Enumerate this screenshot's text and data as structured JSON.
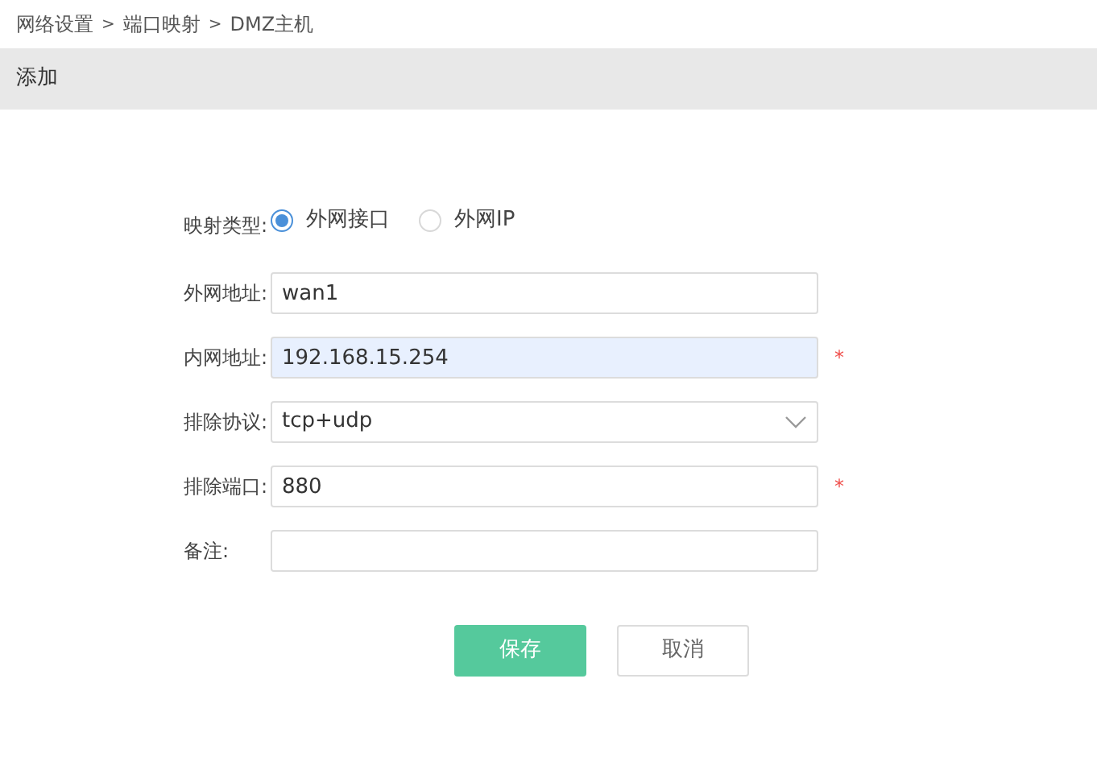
{
  "breadcrumb": {
    "items": [
      "网络设置",
      "端口映射",
      "DMZ主机"
    ],
    "separator": ">"
  },
  "header": {
    "title": "添加"
  },
  "form": {
    "rows": [
      {
        "kind": "radio",
        "label": "映射类型:",
        "options": [
          {
            "label": "外网接口",
            "selected": true
          },
          {
            "label": "外网IP",
            "selected": false
          }
        ]
      },
      {
        "kind": "input",
        "label": "外网地址:",
        "value": "wan1",
        "autofilled": false
      },
      {
        "kind": "input",
        "label": "内网地址:",
        "value": "192.168.15.254",
        "autofilled": true,
        "required_mark": "*"
      },
      {
        "kind": "select",
        "label": "排除协议:",
        "value": "tcp+udp"
      },
      {
        "kind": "input",
        "label": "排除端口:",
        "value": "880",
        "autofilled": false,
        "required_mark": "*"
      },
      {
        "kind": "input",
        "label": "备注:",
        "autofilled": false
      }
    ]
  },
  "buttons": [
    {
      "kind": "primary",
      "label": "保存"
    },
    {
      "kind": "secondary",
      "label": "取消"
    }
  ]
}
